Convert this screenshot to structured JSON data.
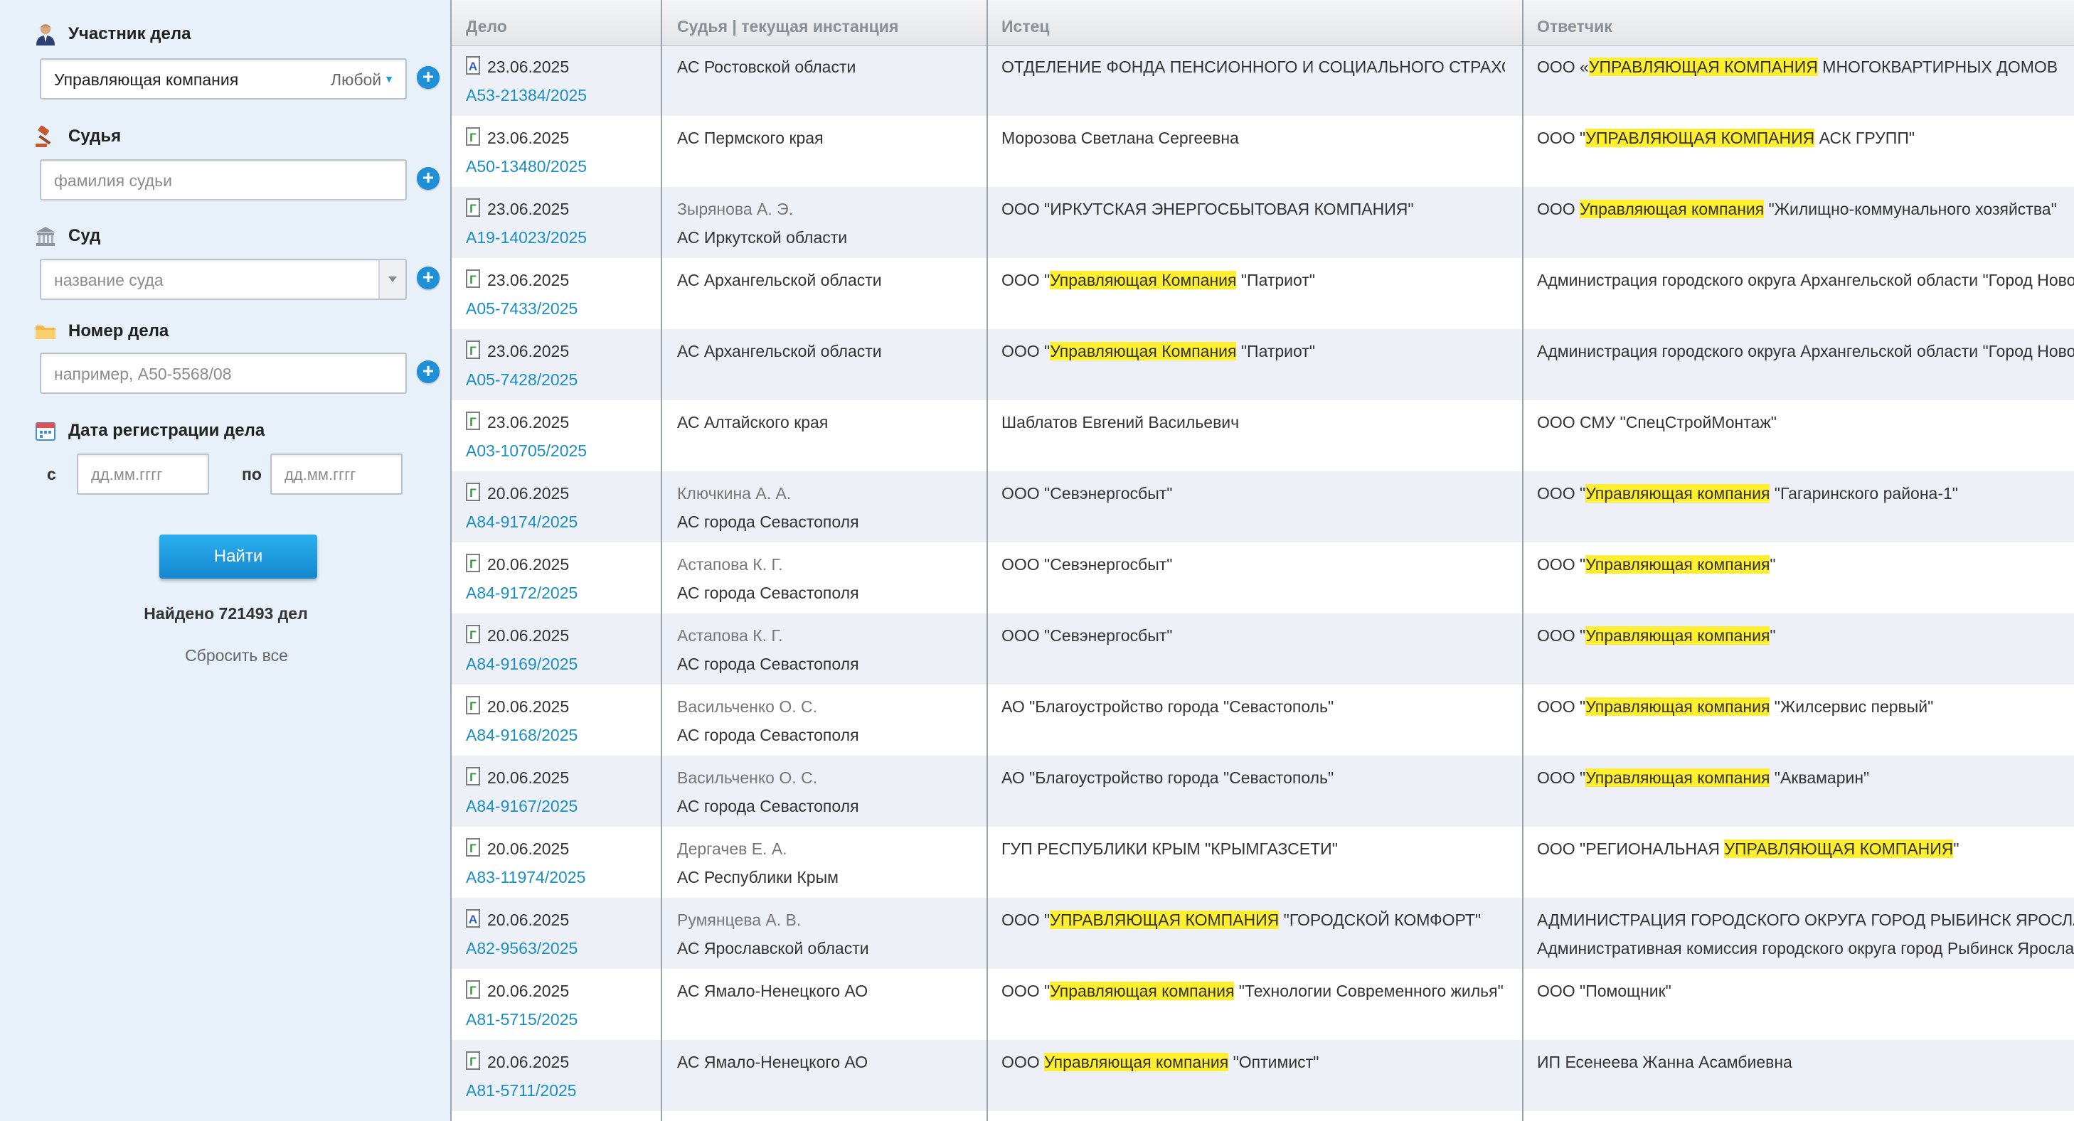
{
  "sidebar": {
    "participant": {
      "title": "Участник дела",
      "value": "Управляющая компания",
      "role": "Любой"
    },
    "judge": {
      "title": "Судья",
      "placeholder": "фамилия судьи"
    },
    "court": {
      "title": "Суд",
      "placeholder": "название суда"
    },
    "case_number": {
      "title": "Номер дела",
      "placeholder": "например, А50-5568/08"
    },
    "reg_date": {
      "title": "Дата регистрации дела",
      "from_label": "с",
      "to_label": "по",
      "from_placeholder": "дд.мм.гггг",
      "to_placeholder": "дд.мм.гггг"
    },
    "find_label": "Найти",
    "found_text": "Найдено 721493 дел",
    "reset_label": "Сбросить все"
  },
  "table": {
    "headers": [
      "Дело",
      "Судья | текущая инстанция",
      "Истец",
      "Ответчик"
    ],
    "rows": [
      {
        "type": "A",
        "date": "23.06.2025",
        "number": "А53-21384/2025",
        "judge": "",
        "court": "АС Ростовской области",
        "plaintiff": [
          {
            "t": "ОТДЕЛЕНИЕ ФОНДА ПЕНСИОННОГО И СОЦИАЛЬНОГО СТРАХОВАНИЯ"
          }
        ],
        "defendant": [
          {
            "t": "ООО «"
          },
          {
            "t": "УПРАВЛЯЮЩАЯ КОМПАНИЯ",
            "hl": true
          },
          {
            "t": " МНОГОКВАРТИРНЫХ ДОМОВ"
          }
        ],
        "defendant2": []
      },
      {
        "type": "G",
        "date": "23.06.2025",
        "number": "А50-13480/2025",
        "judge": "",
        "court": "АС Пермского края",
        "plaintiff": [
          {
            "t": "Морозова Светлана Сергеевна"
          }
        ],
        "defendant": [
          {
            "t": "ООО \""
          },
          {
            "t": "УПРАВЛЯЮЩАЯ КОМПАНИЯ",
            "hl": true
          },
          {
            "t": " АСК ГРУПП\""
          }
        ],
        "defendant2": []
      },
      {
        "type": "G",
        "date": "23.06.2025",
        "number": "А19-14023/2025",
        "judge": "Зырянова А. Э.",
        "court": "АС Иркутской области",
        "plaintiff": [
          {
            "t": "ООО \"ИРКУТСКАЯ ЭНЕРГОСБЫТОВАЯ КОМПАНИЯ\""
          }
        ],
        "defendant": [
          {
            "t": "ООО "
          },
          {
            "t": "Управляющая компания",
            "hl": true
          },
          {
            "t": " \"Жилищно-коммунального хозяйства\""
          }
        ],
        "defendant2": []
      },
      {
        "type": "G",
        "date": "23.06.2025",
        "number": "А05-7433/2025",
        "judge": "",
        "court": "АС Архангельской области",
        "plaintiff": [
          {
            "t": "ООО \""
          },
          {
            "t": "Управляющая Компания",
            "hl": true
          },
          {
            "t": " \"Патриот\""
          }
        ],
        "defendant": [
          {
            "t": "Администрация городского округа Архангельской области \"Город Новодвинск\""
          }
        ],
        "defendant2": []
      },
      {
        "type": "G",
        "date": "23.06.2025",
        "number": "А05-7428/2025",
        "judge": "",
        "court": "АС Архангельской области",
        "plaintiff": [
          {
            "t": "ООО \""
          },
          {
            "t": "Управляющая Компания",
            "hl": true
          },
          {
            "t": " \"Патриот\""
          }
        ],
        "defendant": [
          {
            "t": "Администрация городского округа Архангельской области \"Город Новодвинск\""
          }
        ],
        "defendant2": []
      },
      {
        "type": "G",
        "date": "23.06.2025",
        "number": "А03-10705/2025",
        "judge": "",
        "court": "АС Алтайского края",
        "plaintiff": [
          {
            "t": "Шаблатов Евгений Васильевич"
          }
        ],
        "defendant": [
          {
            "t": "ООО СМУ \"СпецСтройМонтаж\""
          }
        ],
        "defendant2": []
      },
      {
        "type": "G",
        "date": "20.06.2025",
        "number": "А84-9174/2025",
        "judge": "Ключкина А. А.",
        "court": "АС города Севастополя",
        "plaintiff": [
          {
            "t": "ООО \"Севэнергосбыт\""
          }
        ],
        "defendant": [
          {
            "t": "ООО \""
          },
          {
            "t": "Управляющая компания",
            "hl": true
          },
          {
            "t": " \"Гагаринского района-1\""
          }
        ],
        "defendant2": []
      },
      {
        "type": "G",
        "date": "20.06.2025",
        "number": "А84-9172/2025",
        "judge": "Астапова К. Г.",
        "court": "АС города Севастополя",
        "plaintiff": [
          {
            "t": "ООО \"Севэнергосбыт\""
          }
        ],
        "defendant": [
          {
            "t": "ООО \""
          },
          {
            "t": "Управляющая компания",
            "hl": true
          },
          {
            "t": "\""
          }
        ],
        "defendant2": []
      },
      {
        "type": "G",
        "date": "20.06.2025",
        "number": "А84-9169/2025",
        "judge": "Астапова К. Г.",
        "court": "АС города Севастополя",
        "plaintiff": [
          {
            "t": "ООО \"Севэнергосбыт\""
          }
        ],
        "defendant": [
          {
            "t": "ООО \""
          },
          {
            "t": "Управляющая компания",
            "hl": true
          },
          {
            "t": "\""
          }
        ],
        "defendant2": []
      },
      {
        "type": "G",
        "date": "20.06.2025",
        "number": "А84-9168/2025",
        "judge": "Васильченко О. С.",
        "court": "АС города Севастополя",
        "plaintiff": [
          {
            "t": "АО \"Благоустройство города \"Севастополь\""
          }
        ],
        "defendant": [
          {
            "t": "ООО \""
          },
          {
            "t": "Управляющая компания",
            "hl": true
          },
          {
            "t": " \"Жилсервис первый\""
          }
        ],
        "defendant2": []
      },
      {
        "type": "G",
        "date": "20.06.2025",
        "number": "А84-9167/2025",
        "judge": "Васильченко О. С.",
        "court": "АС города Севастополя",
        "plaintiff": [
          {
            "t": "АО \"Благоустройство города \"Севастополь\""
          }
        ],
        "defendant": [
          {
            "t": "ООО \""
          },
          {
            "t": "Управляющая компания",
            "hl": true
          },
          {
            "t": " \"Аквамарин\""
          }
        ],
        "defendant2": []
      },
      {
        "type": "G",
        "date": "20.06.2025",
        "number": "А83-11974/2025",
        "judge": "Дергачев Е. А.",
        "court": "АС Республики Крым",
        "plaintiff": [
          {
            "t": "ГУП РЕСПУБЛИКИ КРЫМ \"КРЫМГАЗСЕТИ\""
          }
        ],
        "defendant": [
          {
            "t": "ООО \"РЕГИОНАЛЬНАЯ "
          },
          {
            "t": "УПРАВЛЯЮЩАЯ КОМПАНИЯ",
            "hl": true
          },
          {
            "t": "\""
          }
        ],
        "defendant2": []
      },
      {
        "type": "A",
        "date": "20.06.2025",
        "number": "А82-9563/2025",
        "judge": "Румянцева А. В.",
        "court": "АС Ярославской области",
        "plaintiff": [
          {
            "t": "ООО \""
          },
          {
            "t": "УПРАВЛЯЮЩАЯ КОМПАНИЯ",
            "hl": true
          },
          {
            "t": " \"ГОРОДСКОЙ КОМФОРТ\""
          }
        ],
        "defendant": [
          {
            "t": "АДМИНИСТРАЦИЯ ГОРОДСКОГО ОКРУГА ГОРОД РЫБИНСК ЯРОСЛАВСКОЙ ОБЛАСТИ"
          }
        ],
        "defendant2": [
          {
            "t": "Административная комиссия городского округа город Рыбинск Ярославской области"
          }
        ]
      },
      {
        "type": "G",
        "date": "20.06.2025",
        "number": "А81-5715/2025",
        "judge": "",
        "court": "АС Ямало-Ненецкого АО",
        "plaintiff": [
          {
            "t": "ООО \""
          },
          {
            "t": "Управляющая компания",
            "hl": true
          },
          {
            "t": " \"Технологии Современного жилья\""
          }
        ],
        "defendant": [
          {
            "t": "ООО \"Помощник\""
          }
        ],
        "defendant2": []
      },
      {
        "type": "G",
        "date": "20.06.2025",
        "number": "А81-5711/2025",
        "judge": "",
        "court": "АС Ямало-Ненецкого АО",
        "plaintiff": [
          {
            "t": "ООО "
          },
          {
            "t": "Управляющая компания",
            "hl": true
          },
          {
            "t": " \"Оптимист\""
          }
        ],
        "defendant": [
          {
            "t": "ИП Есенеева Жанна Асамбиевна"
          }
        ],
        "defendant2": []
      }
    ]
  },
  "colors": {
    "link": "#1a8fc2",
    "highlight": "#ffef2e",
    "button": "#1e90d8",
    "sidebar_bg": "#e8f0fa",
    "row_alt": "#eef0f8"
  }
}
